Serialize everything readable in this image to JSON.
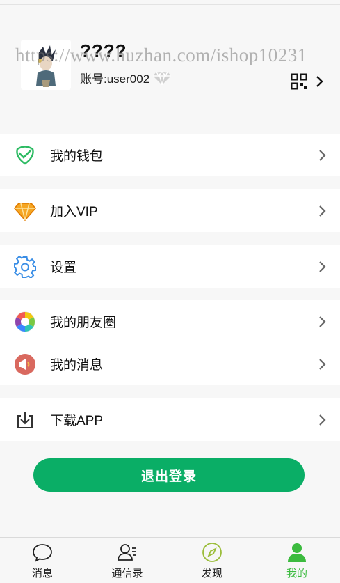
{
  "profile": {
    "nickname": "????",
    "account": "账号:user002",
    "watermark": "https://www.huzhan.com/ishop10231"
  },
  "menu": [
    {
      "label": "我的钱包",
      "icon": "wallet-icon"
    },
    {
      "label": "加入VIP",
      "icon": "vip-diamond-icon"
    },
    {
      "label": "设置",
      "icon": "gear-icon"
    },
    {
      "label": "我的朋友圈",
      "icon": "moments-icon"
    },
    {
      "label": "我的消息",
      "icon": "message-icon"
    },
    {
      "label": "下载APP",
      "icon": "download-icon"
    }
  ],
  "logout_label": "退出登录",
  "tabs": [
    {
      "label": "消息",
      "icon": "chat-bubble-icon"
    },
    {
      "label": "通信录",
      "icon": "contacts-icon"
    },
    {
      "label": "发现",
      "icon": "compass-icon"
    },
    {
      "label": "我的",
      "icon": "person-icon",
      "active": true
    }
  ],
  "colors": {
    "accent": "#0aae66",
    "active_tab": "#3cbb3f",
    "background": "#f7f7f7"
  }
}
